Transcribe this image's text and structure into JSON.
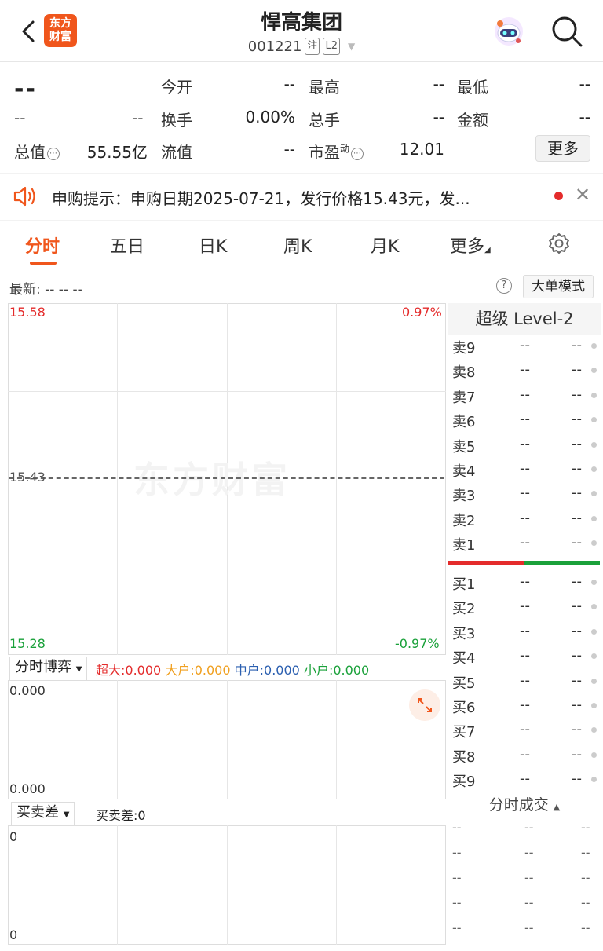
{
  "header": {
    "title": "悍高集团",
    "code": "001221",
    "tag1": "注",
    "tag2": "L2",
    "logo_line1": "东方",
    "logo_line2": "财富"
  },
  "quote": {
    "price": "--",
    "change": "--",
    "change_pct": "--",
    "open_label": "今开",
    "open_value": "--",
    "high_label": "最高",
    "high_value": "--",
    "low_label": "最低",
    "low_value": "--",
    "turnover_label": "换手",
    "turnover_value": "0.00%",
    "volume_label": "总手",
    "volume_value": "--",
    "amount_label": "金额",
    "amount_value": "--",
    "mktcap_label": "总值",
    "mktcap_value": "55.55亿",
    "float_label": "流值",
    "float_value": "--",
    "pe_label": "市盈",
    "pe_sup": "动",
    "pe_value": "12.01",
    "more_label": "更多"
  },
  "notice": {
    "text": "申购提示：申购日期2025-07-21，发行价格15.43元，发..."
  },
  "tabs": [
    "分时",
    "五日",
    "日K",
    "周K",
    "月K",
    "更多"
  ],
  "latest": {
    "label": "最新:  --  --  --",
    "help": "?",
    "big_order_mode": "大单模式"
  },
  "chart": {
    "top_price": "15.58",
    "top_pct": "0.97%",
    "mid_price": "15.43",
    "bottom_price": "15.28",
    "bottom_pct": "-0.97%",
    "watermark": "东方财富"
  },
  "game_panel": {
    "selector": "分时博弈",
    "super_label": "超大:",
    "super_value": "0.000",
    "big_label": "大户:",
    "big_value": "0.000",
    "mid_label": "中户:",
    "mid_value": "0.000",
    "small_label": "小户:",
    "small_value": "0.000",
    "y_top": "0.000",
    "y_bottom": "0.000",
    "colors": {
      "super": "#e42b2b",
      "big": "#f0a020",
      "mid": "#2b5fb0",
      "small": "#1aa13a"
    }
  },
  "diff_panel": {
    "selector": "买卖差",
    "label": "买卖差:0",
    "y_top": "0",
    "y_bottom": "0"
  },
  "level2": {
    "title": "超级 Level-2",
    "sells": [
      {
        "label": "卖9",
        "price": "--",
        "vol": "--"
      },
      {
        "label": "卖8",
        "price": "--",
        "vol": "--"
      },
      {
        "label": "卖7",
        "price": "--",
        "vol": "--"
      },
      {
        "label": "卖6",
        "price": "--",
        "vol": "--"
      },
      {
        "label": "卖5",
        "price": "--",
        "vol": "--"
      },
      {
        "label": "卖4",
        "price": "--",
        "vol": "--"
      },
      {
        "label": "卖3",
        "price": "--",
        "vol": "--"
      },
      {
        "label": "卖2",
        "price": "--",
        "vol": "--"
      },
      {
        "label": "卖1",
        "price": "--",
        "vol": "--"
      }
    ],
    "buys": [
      {
        "label": "买1",
        "price": "--",
        "vol": "--"
      },
      {
        "label": "买2",
        "price": "--",
        "vol": "--"
      },
      {
        "label": "买3",
        "price": "--",
        "vol": "--"
      },
      {
        "label": "买4",
        "price": "--",
        "vol": "--"
      },
      {
        "label": "买5",
        "price": "--",
        "vol": "--"
      },
      {
        "label": "买6",
        "price": "--",
        "vol": "--"
      },
      {
        "label": "买7",
        "price": "--",
        "vol": "--"
      },
      {
        "label": "买8",
        "price": "--",
        "vol": "--"
      },
      {
        "label": "买9",
        "price": "--",
        "vol": "--"
      }
    ],
    "trades_title": "分时成交",
    "trades": [
      {
        "time": "--",
        "price": "--",
        "vol": "--"
      },
      {
        "time": "--",
        "price": "--",
        "vol": "--"
      },
      {
        "time": "--",
        "price": "--",
        "vol": "--"
      },
      {
        "time": "--",
        "price": "--",
        "vol": "--"
      },
      {
        "time": "--",
        "price": "--",
        "vol": "--"
      }
    ]
  },
  "colors": {
    "accent": "#f0561c",
    "up": "#e42b2b",
    "down": "#1aa13a"
  }
}
